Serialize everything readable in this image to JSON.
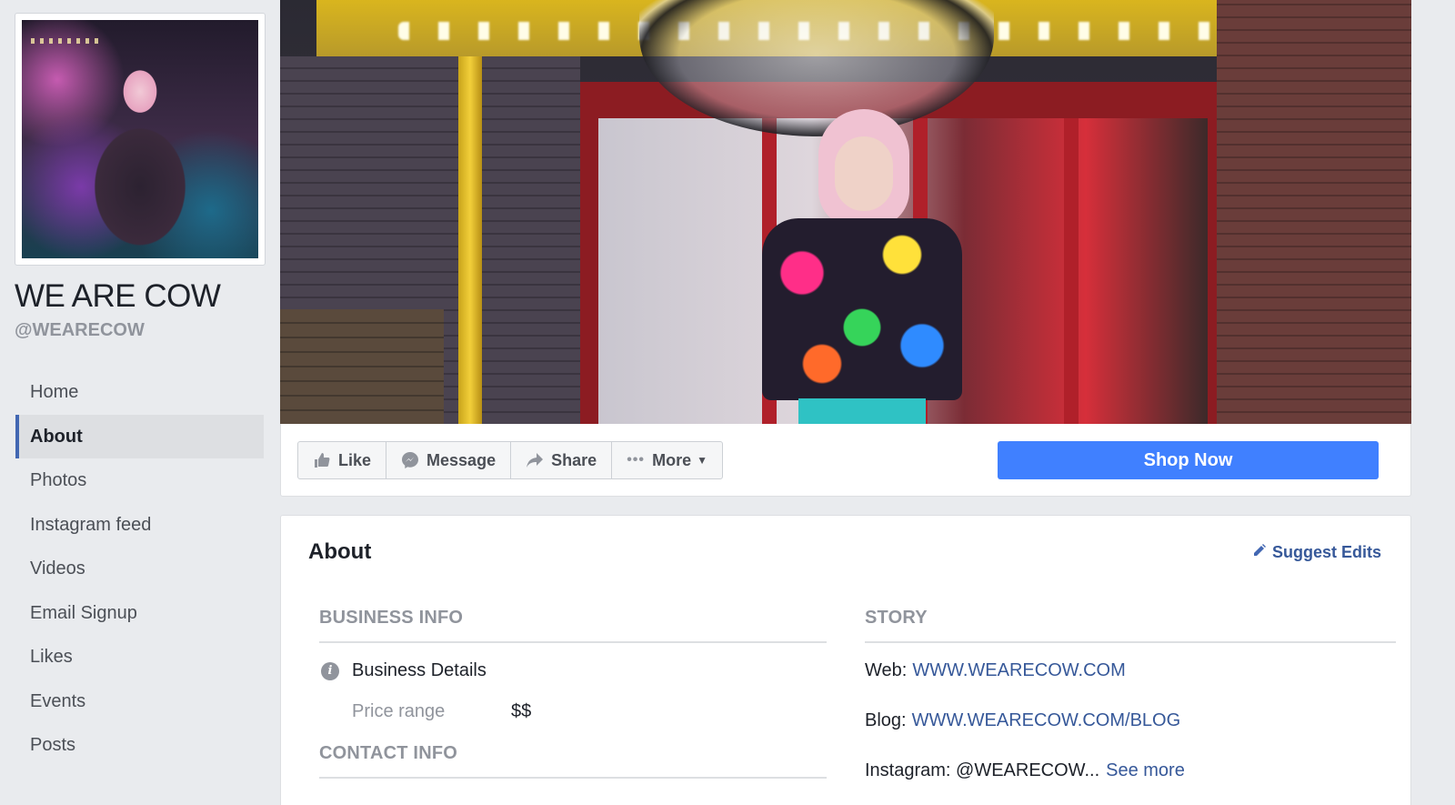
{
  "page": {
    "name": "WE ARE COW",
    "handle": "@WEARECOW"
  },
  "sidebar": {
    "items": [
      {
        "label": "Home"
      },
      {
        "label": "About"
      },
      {
        "label": "Photos"
      },
      {
        "label": "Instagram feed"
      },
      {
        "label": "Videos"
      },
      {
        "label": "Email Signup"
      },
      {
        "label": "Likes"
      },
      {
        "label": "Events"
      },
      {
        "label": "Posts"
      }
    ],
    "active": "About"
  },
  "actions": {
    "like": "Like",
    "message": "Message",
    "share": "Share",
    "more": "More",
    "shop_now": "Shop Now"
  },
  "about": {
    "title": "About",
    "suggest_edits": "Suggest Edits",
    "business_info": {
      "heading": "BUSINESS INFO",
      "details_label": "Business Details",
      "price_range_label": "Price range",
      "price_range_value": "$$"
    },
    "contact_info": {
      "heading": "CONTACT INFO"
    },
    "story": {
      "heading": "STORY",
      "web_label": "Web:",
      "web_value": "WWW.WEARECOW.COM",
      "blog_label": "Blog:",
      "blog_value": "WWW.WEARECOW.COM/BLOG",
      "instagram_label": "Instagram: @WEARECOW...",
      "see_more": "See more"
    }
  },
  "colors": {
    "accent": "#4080ff",
    "link": "#365899",
    "active_border": "#4267b2",
    "background": "#e9ebee"
  },
  "icons": {
    "like": "thumbs-up-icon",
    "message": "messenger-icon",
    "share": "share-arrow-icon",
    "more": "ellipsis-icon",
    "dropdown": "caret-down-icon",
    "suggest": "pencil-icon",
    "info": "info-icon"
  }
}
